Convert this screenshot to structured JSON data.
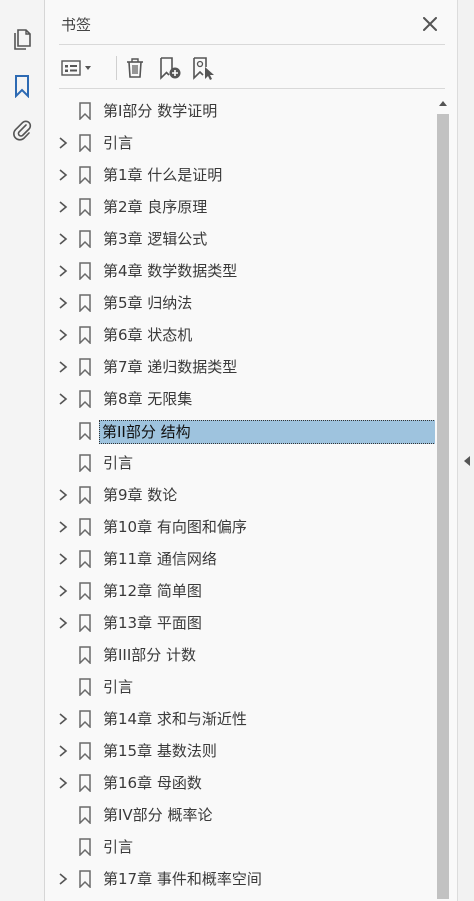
{
  "panel": {
    "title": "书签"
  },
  "left_rail": {
    "icons": [
      "pages-icon",
      "bookmark-icon",
      "attachment-icon"
    ]
  },
  "toolbar": {
    "icons": [
      "options-menu-icon",
      "delete-icon",
      "new-bookmark-icon",
      "bookmark-from-selection-icon"
    ]
  },
  "bookmarks": [
    {
      "label": "第I部分 数学证明",
      "expandable": false,
      "selected": false
    },
    {
      "label": "引言",
      "expandable": true,
      "selected": false
    },
    {
      "label": "第1章 什么是证明",
      "expandable": true,
      "selected": false
    },
    {
      "label": "第2章 良序原理",
      "expandable": true,
      "selected": false
    },
    {
      "label": "第3章 逻辑公式",
      "expandable": true,
      "selected": false
    },
    {
      "label": "第4章 数学数据类型",
      "expandable": true,
      "selected": false
    },
    {
      "label": "第5章 归纳法",
      "expandable": true,
      "selected": false
    },
    {
      "label": "第6章 状态机",
      "expandable": true,
      "selected": false
    },
    {
      "label": "第7章 递归数据类型",
      "expandable": true,
      "selected": false
    },
    {
      "label": "第8章 无限集",
      "expandable": true,
      "selected": false
    },
    {
      "label": "第II部分 结构",
      "expandable": false,
      "selected": true
    },
    {
      "label": "引言",
      "expandable": false,
      "selected": false
    },
    {
      "label": "第9章 数论",
      "expandable": true,
      "selected": false
    },
    {
      "label": "第10章 有向图和偏序",
      "expandable": true,
      "selected": false
    },
    {
      "label": "第11章 通信网络",
      "expandable": true,
      "selected": false
    },
    {
      "label": "第12章 简单图",
      "expandable": true,
      "selected": false
    },
    {
      "label": "第13章 平面图",
      "expandable": true,
      "selected": false
    },
    {
      "label": "第III部分 计数",
      "expandable": false,
      "selected": false
    },
    {
      "label": "引言",
      "expandable": false,
      "selected": false
    },
    {
      "label": "第14章 求和与渐近性",
      "expandable": true,
      "selected": false
    },
    {
      "label": "第15章 基数法则",
      "expandable": true,
      "selected": false
    },
    {
      "label": "第16章 母函数",
      "expandable": true,
      "selected": false
    },
    {
      "label": "第IV部分 概率论",
      "expandable": false,
      "selected": false
    },
    {
      "label": "引言",
      "expandable": false,
      "selected": false
    },
    {
      "label": "第17章 事件和概率空间",
      "expandable": true,
      "selected": false
    }
  ],
  "colors": {
    "accent": "#2d6ab3",
    "selection": "#9ec3de"
  }
}
